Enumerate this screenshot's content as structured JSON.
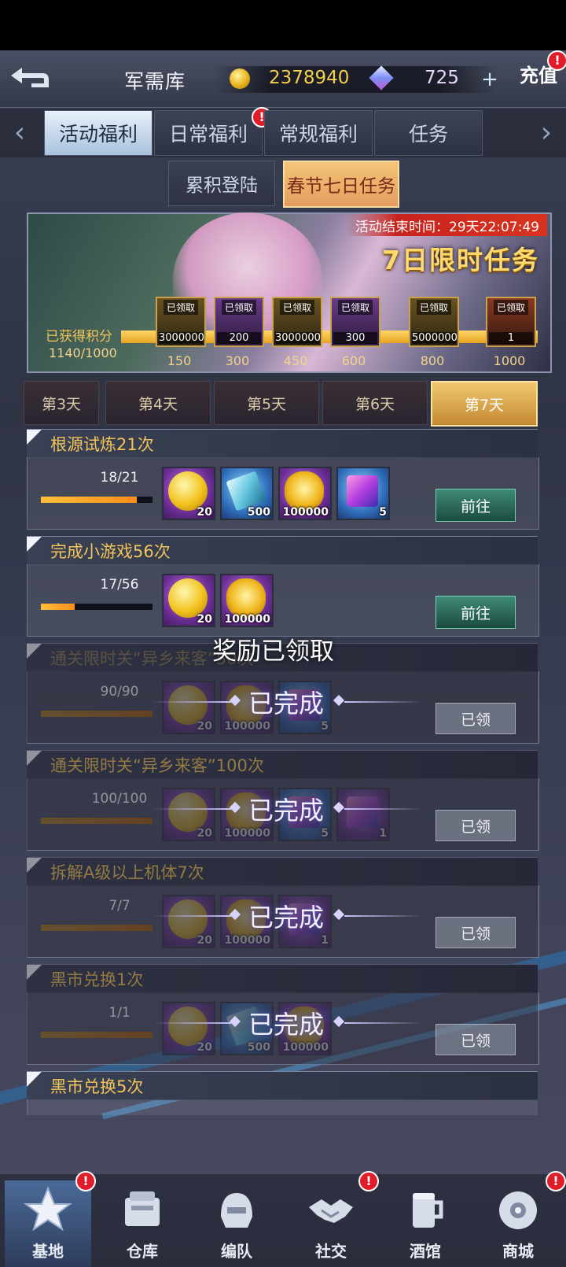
{
  "header": {
    "title": "军需库",
    "gold": "2378940",
    "gems": "725",
    "plus_label": "+",
    "recharge_label": "充值",
    "recharge_badge": "!"
  },
  "tabs": [
    {
      "label": "活动福利",
      "active": true
    },
    {
      "label": "日常福利",
      "badge": "!"
    },
    {
      "label": "常规福利"
    },
    {
      "label": "任务"
    }
  ],
  "subtabs": [
    {
      "label": "累积登陆"
    },
    {
      "label": "春节七日任务",
      "active": true
    }
  ],
  "banner": {
    "end_time": "活动结束时间：29天22:07:49",
    "title": "7日限时任务",
    "points_label": "已获得积分",
    "points_value": "1140/1000",
    "progress": 1.0,
    "milestones": [
      {
        "claim": "已领取",
        "amount": "3000000",
        "tick": "150"
      },
      {
        "claim": "已领取",
        "amount": "200",
        "tick": "300"
      },
      {
        "claim": "已领取",
        "amount": "3000000",
        "tick": "450"
      },
      {
        "claim": "已领取",
        "amount": "300",
        "tick": "600"
      },
      {
        "claim": "已领取",
        "amount": "5000000",
        "tick": "800"
      },
      {
        "claim": "已领取",
        "amount": "1",
        "tick": "1000"
      }
    ]
  },
  "days": [
    {
      "label": "第3天"
    },
    {
      "label": "第4天"
    },
    {
      "label": "第5天"
    },
    {
      "label": "第6天"
    },
    {
      "label": "第7天",
      "active": true
    }
  ],
  "tasks": [
    {
      "title": "根源试炼21次",
      "progress": "18/21",
      "ratio": 0.857,
      "rewards": [
        "20",
        "500",
        "100000",
        "5"
      ],
      "button": "前往"
    },
    {
      "title": "完成小游戏56次",
      "progress": "17/56",
      "ratio": 0.304,
      "rewards": [
        "20",
        "100000"
      ],
      "button": "前往"
    },
    {
      "title": "通关限时关“异乡来客”50次",
      "progress": "90/90",
      "ratio": 1.0,
      "rewards": [
        "20",
        "100000",
        "5"
      ],
      "button": "已领",
      "done": "已完成"
    },
    {
      "title": "通关限时关“异乡来客”100次",
      "progress": "100/100",
      "ratio": 1.0,
      "rewards": [
        "20",
        "100000",
        "5",
        "1"
      ],
      "button": "已领",
      "done": "已完成"
    },
    {
      "title": "拆解A级以上机体7次",
      "progress": "7/7",
      "ratio": 1.0,
      "rewards": [
        "20",
        "100000",
        "1"
      ],
      "button": "已领",
      "done": "已完成"
    },
    {
      "title": "黑市兑换1次",
      "progress": "1/1",
      "ratio": 1.0,
      "rewards": [
        "20",
        "500",
        "100000"
      ],
      "button": "已领",
      "done": "已完成"
    },
    {
      "title": "黑市兑换5次"
    }
  ],
  "toast": "奖励已领取",
  "nav": [
    {
      "label": "基地",
      "icon": "base-emblem-icon",
      "active": true,
      "badge": "!"
    },
    {
      "label": "仓库",
      "icon": "warehouse-crate-icon"
    },
    {
      "label": "编队",
      "icon": "formation-helmet-icon"
    },
    {
      "label": "社交",
      "icon": "handshake-icon",
      "badge": "!"
    },
    {
      "label": "酒馆",
      "icon": "tavern-mug-icon"
    },
    {
      "label": "商城",
      "icon": "shop-robot-icon",
      "badge": "!"
    }
  ]
}
